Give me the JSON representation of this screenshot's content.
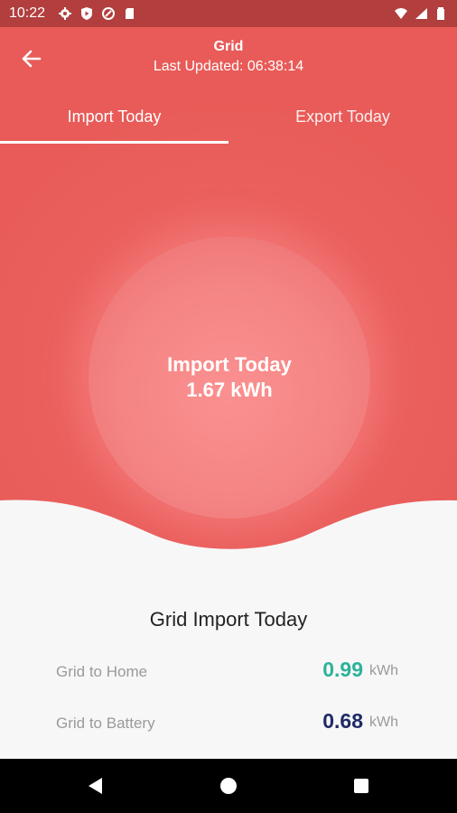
{
  "status_bar": {
    "time": "10:22",
    "left_icons": [
      "gear-icon",
      "play-protect-icon",
      "data-saver-icon",
      "sd-card-icon"
    ],
    "right_icons": [
      "wifi-icon",
      "signal-icon",
      "battery-icon"
    ]
  },
  "header": {
    "title": "Grid",
    "subtitle": "Last Updated: 06:38:14",
    "back_icon": "arrow-left-icon"
  },
  "tabs": [
    {
      "label": "Import Today",
      "active": true
    },
    {
      "label": "Export Today",
      "active": false
    }
  ],
  "bubble": {
    "label": "Import Today",
    "value": "1.67 kWh"
  },
  "panel": {
    "title": "Grid Import Today",
    "rows": [
      {
        "label": "Grid to Home",
        "value": "0.99",
        "unit": "kWh",
        "color": "#2bb39a"
      },
      {
        "label": "Grid to Battery",
        "value": "0.68",
        "unit": "kWh",
        "color": "#1f2a66"
      }
    ]
  },
  "colors": {
    "accent": "#e85b58",
    "status_bar": "#b23e3e"
  },
  "nav": [
    "back-triangle-icon",
    "home-circle-icon",
    "recents-square-icon"
  ]
}
